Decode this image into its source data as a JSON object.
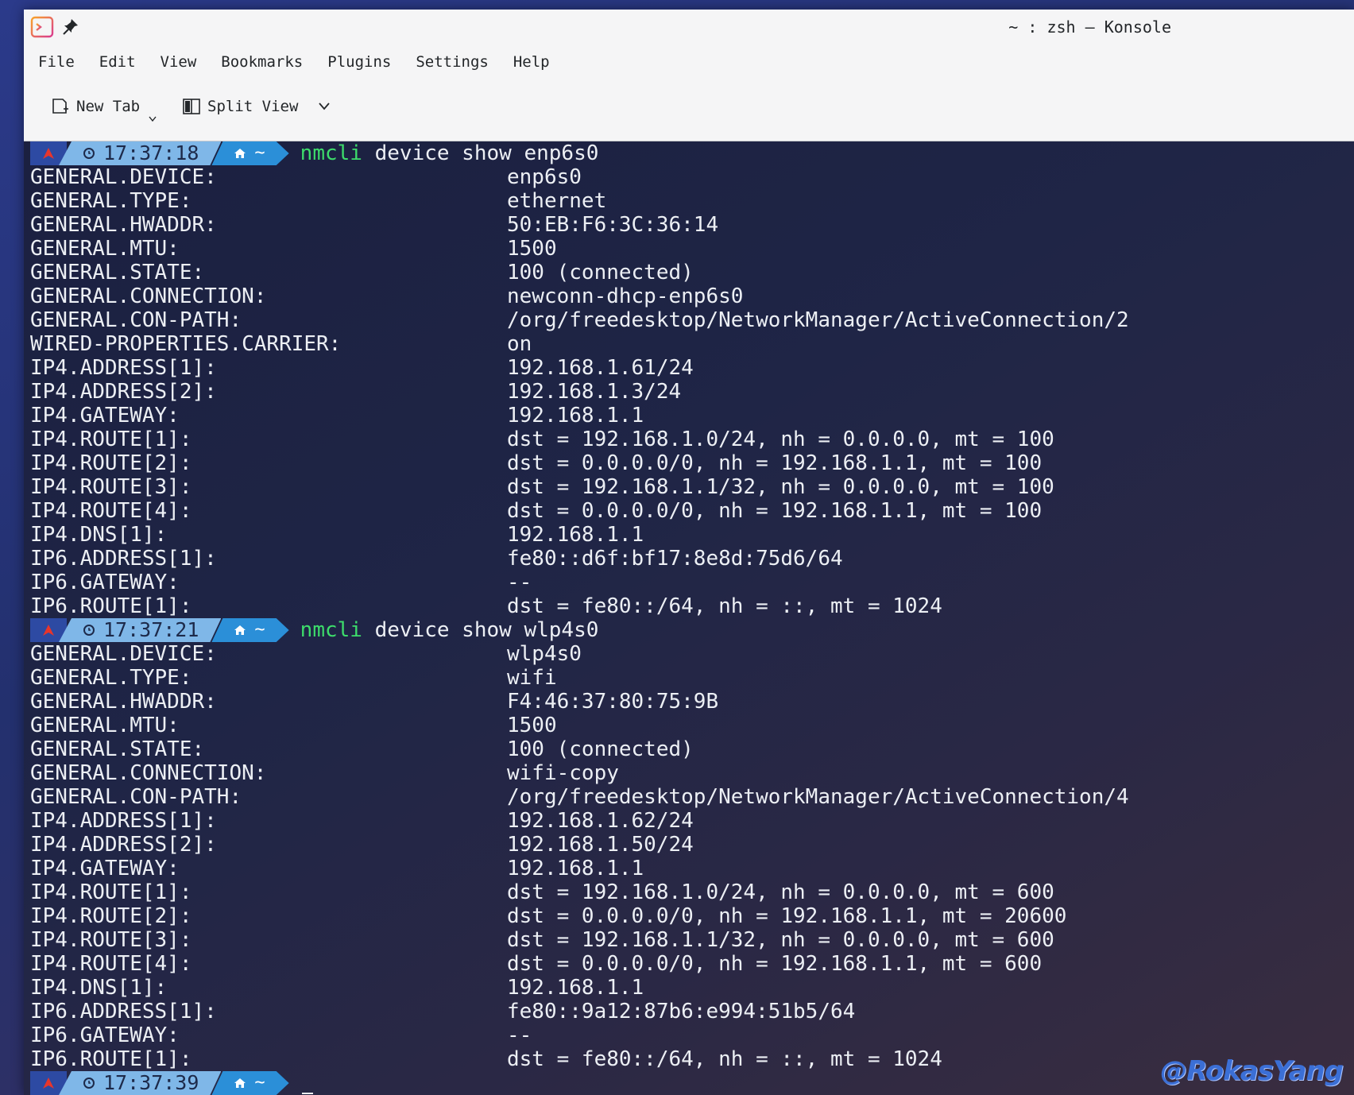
{
  "window": {
    "title": "~ : zsh — Konsole"
  },
  "menu": [
    "File",
    "Edit",
    "View",
    "Bookmarks",
    "Plugins",
    "Settings",
    "Help"
  ],
  "toolbar": {
    "new_tab": "New Tab",
    "split_view": "Split View"
  },
  "blocks": [
    {
      "time": "17:37:18",
      "home": "~",
      "cmd_name": "nmcli",
      "cmd_args": "device show enp6s0",
      "rows": [
        [
          "GENERAL.DEVICE:",
          "enp6s0"
        ],
        [
          "GENERAL.TYPE:",
          "ethernet"
        ],
        [
          "GENERAL.HWADDR:",
          "50:EB:F6:3C:36:14"
        ],
        [
          "GENERAL.MTU:",
          "1500"
        ],
        [
          "GENERAL.STATE:",
          "100 (connected)"
        ],
        [
          "GENERAL.CONNECTION:",
          "newconn-dhcp-enp6s0"
        ],
        [
          "GENERAL.CON-PATH:",
          "/org/freedesktop/NetworkManager/ActiveConnection/2"
        ],
        [
          "WIRED-PROPERTIES.CARRIER:",
          "on"
        ],
        [
          "IP4.ADDRESS[1]:",
          "192.168.1.61/24"
        ],
        [
          "IP4.ADDRESS[2]:",
          "192.168.1.3/24"
        ],
        [
          "IP4.GATEWAY:",
          "192.168.1.1"
        ],
        [
          "IP4.ROUTE[1]:",
          "dst = 192.168.1.0/24, nh = 0.0.0.0, mt = 100"
        ],
        [
          "IP4.ROUTE[2]:",
          "dst = 0.0.0.0/0, nh = 192.168.1.1, mt = 100"
        ],
        [
          "IP4.ROUTE[3]:",
          "dst = 192.168.1.1/32, nh = 0.0.0.0, mt = 100"
        ],
        [
          "IP4.ROUTE[4]:",
          "dst = 0.0.0.0/0, nh = 192.168.1.1, mt = 100"
        ],
        [
          "IP4.DNS[1]:",
          "192.168.1.1"
        ],
        [
          "IP6.ADDRESS[1]:",
          "fe80::d6f:bf17:8e8d:75d6/64"
        ],
        [
          "IP6.GATEWAY:",
          "--"
        ],
        [
          "IP6.ROUTE[1]:",
          "dst = fe80::/64, nh = ::, mt = 1024"
        ]
      ]
    },
    {
      "time": "17:37:21",
      "home": "~",
      "cmd_name": "nmcli",
      "cmd_args": "device show wlp4s0",
      "rows": [
        [
          "GENERAL.DEVICE:",
          "wlp4s0"
        ],
        [
          "GENERAL.TYPE:",
          "wifi"
        ],
        [
          "GENERAL.HWADDR:",
          "F4:46:37:80:75:9B"
        ],
        [
          "GENERAL.MTU:",
          "1500"
        ],
        [
          "GENERAL.STATE:",
          "100 (connected)"
        ],
        [
          "GENERAL.CONNECTION:",
          "wifi-copy"
        ],
        [
          "GENERAL.CON-PATH:",
          "/org/freedesktop/NetworkManager/ActiveConnection/4"
        ],
        [
          "IP4.ADDRESS[1]:",
          "192.168.1.62/24"
        ],
        [
          "IP4.ADDRESS[2]:",
          "192.168.1.50/24"
        ],
        [
          "IP4.GATEWAY:",
          "192.168.1.1"
        ],
        [
          "IP4.ROUTE[1]:",
          "dst = 192.168.1.0/24, nh = 0.0.0.0, mt = 600"
        ],
        [
          "IP4.ROUTE[2]:",
          "dst = 0.0.0.0/0, nh = 192.168.1.1, mt = 20600"
        ],
        [
          "IP4.ROUTE[3]:",
          "dst = 192.168.1.1/32, nh = 0.0.0.0, mt = 600"
        ],
        [
          "IP4.ROUTE[4]:",
          "dst = 0.0.0.0/0, nh = 192.168.1.1, mt = 600"
        ],
        [
          "IP4.DNS[1]:",
          "192.168.1.1"
        ],
        [
          "IP6.ADDRESS[1]:",
          "fe80::9a12:87b6:e994:51b5/64"
        ],
        [
          "IP6.GATEWAY:",
          "--"
        ],
        [
          "IP6.ROUTE[1]:",
          "dst = fe80::/64, nh = ::, mt = 1024"
        ]
      ]
    }
  ],
  "final_prompt": {
    "time": "17:37:39",
    "home": "~"
  },
  "watermark": "@RokasYang",
  "colors": {
    "command": "#3ddc6b",
    "prompt_time_bg": "#7fb7e8",
    "prompt_home_bg": "#2b8fd8",
    "arch_red": "#e8352b"
  }
}
